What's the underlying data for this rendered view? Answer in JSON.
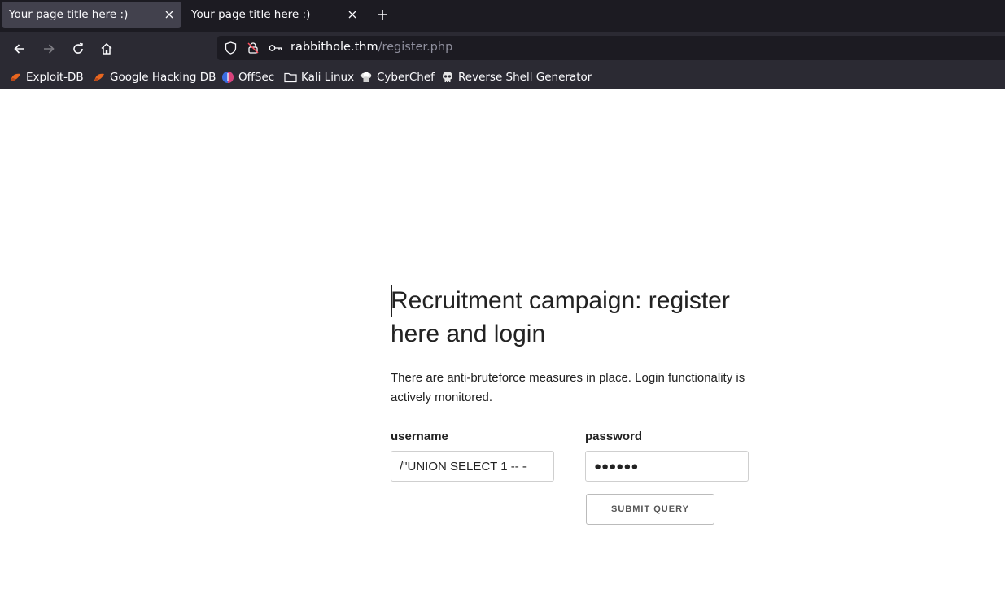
{
  "tabs": [
    {
      "title": "Your page title here :)",
      "active": true
    },
    {
      "title": "Your page title here :)",
      "active": false
    }
  ],
  "address": {
    "host": "rabbithole.thm",
    "path": "/register.php"
  },
  "bookmarks": [
    {
      "label": "Exploit-DB",
      "icon": "exploit-db-icon"
    },
    {
      "label": "Google Hacking DB",
      "icon": "ghdb-icon"
    },
    {
      "label": "OffSec",
      "icon": "offsec-icon"
    },
    {
      "label": "Kali Linux",
      "icon": "folder-icon"
    },
    {
      "label": "CyberChef",
      "icon": "cyberchef-icon"
    },
    {
      "label": "Reverse Shell Generator",
      "icon": "skull-icon"
    }
  ],
  "page": {
    "heading": "Recruitment campaign: register here and login",
    "description": "There are anti-bruteforce measures in place. Login functionality is actively monitored.",
    "username_label": "username",
    "username_value": "/\"UNION SELECT 1 -- -",
    "password_label": "password",
    "password_mask": "●●●●●●",
    "submit_label": "SUBMIT QUERY"
  },
  "colors": {
    "tabstrip_bg": "#1c1b22",
    "toolbar_bg": "#2b2a33",
    "active_tab_bg": "#42414d",
    "text_light": "#fbfbfe",
    "url_path": "#8f8f9d"
  }
}
